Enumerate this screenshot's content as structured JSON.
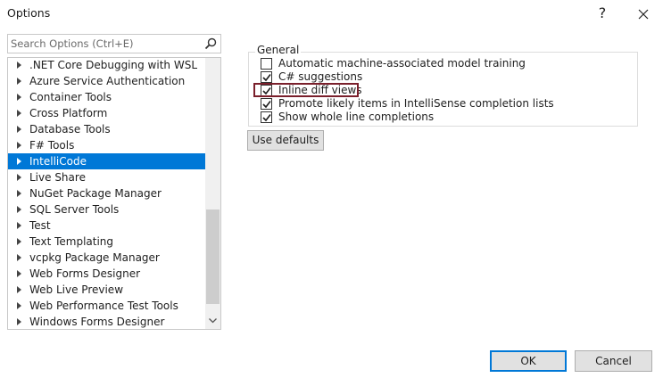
{
  "window": {
    "title": "Options",
    "help_label": "?",
    "close_icon": "close-icon"
  },
  "search": {
    "placeholder": "Search Options (Ctrl+E)",
    "icon": "search-icon"
  },
  "tree": {
    "items": [
      {
        "label": ".NET Core Debugging with WSL",
        "selected": false
      },
      {
        "label": "Azure Service Authentication",
        "selected": false
      },
      {
        "label": "Container Tools",
        "selected": false
      },
      {
        "label": "Cross Platform",
        "selected": false
      },
      {
        "label": "Database Tools",
        "selected": false
      },
      {
        "label": "F# Tools",
        "selected": false
      },
      {
        "label": "IntelliCode",
        "selected": true
      },
      {
        "label": "Live Share",
        "selected": false
      },
      {
        "label": "NuGet Package Manager",
        "selected": false
      },
      {
        "label": "SQL Server Tools",
        "selected": false
      },
      {
        "label": "Test",
        "selected": false
      },
      {
        "label": "Text Templating",
        "selected": false
      },
      {
        "label": "vcpkg Package Manager",
        "selected": false
      },
      {
        "label": "Web Forms Designer",
        "selected": false
      },
      {
        "label": "Web Live Preview",
        "selected": false
      },
      {
        "label": "Web Performance Test Tools",
        "selected": false
      },
      {
        "label": "Windows Forms Designer",
        "selected": false
      }
    ]
  },
  "general": {
    "group_label": "General",
    "options": [
      {
        "label": "Automatic machine-associated model training",
        "checked": false
      },
      {
        "label": "C# suggestions",
        "checked": true
      },
      {
        "label": "Inline diff views",
        "checked": true
      },
      {
        "label": "Promote likely items in IntelliSense completion lists",
        "checked": true
      },
      {
        "label": "Show whole line completions",
        "checked": true
      }
    ],
    "highlight_color": "#7a1f2b"
  },
  "buttons": {
    "use_defaults": "Use defaults",
    "ok": "OK",
    "cancel": "Cancel"
  },
  "colors": {
    "selection": "#0078d7",
    "accent": "#0078d7"
  }
}
